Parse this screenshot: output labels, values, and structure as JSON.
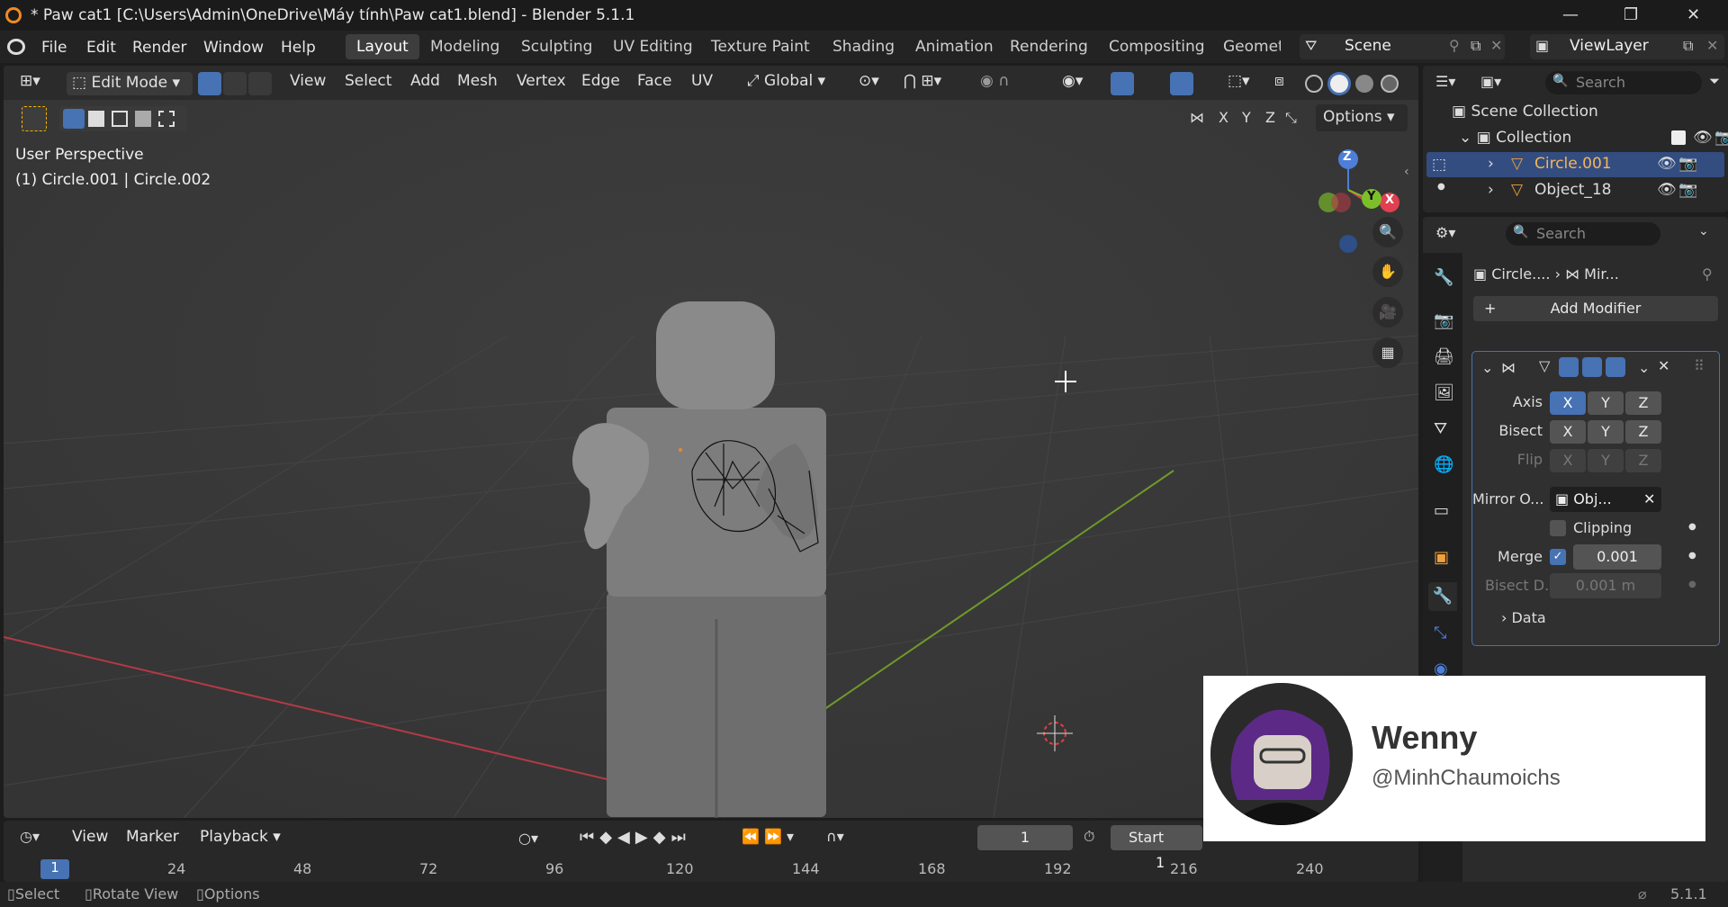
{
  "window": {
    "title": "* Paw cat1 [C:\\Users\\Admin\\OneDrive\\Máy tính\\Paw cat1.blend] - Blender 5.1.1"
  },
  "menu": [
    "File",
    "Edit",
    "Render",
    "Window",
    "Help"
  ],
  "workspaces": [
    "Layout",
    "Modeling",
    "Sculpting",
    "UV Editing",
    "Texture Paint",
    "Shading",
    "Animation",
    "Rendering",
    "Compositing",
    "Geometr"
  ],
  "scene": {
    "label": "Scene",
    "view_layer": "ViewLayer"
  },
  "viewport_header": {
    "mode": "Edit Mode",
    "menus": [
      "View",
      "Select",
      "Add",
      "Mesh",
      "Vertex",
      "Edge",
      "Face",
      "UV"
    ],
    "transform_orientation": "Global",
    "options": "Options",
    "axes": [
      "X",
      "Y",
      "Z"
    ]
  },
  "viewport": {
    "perspective": "User Perspective",
    "object_info": "(1) Circle.001 | Circle.002",
    "gizmo_axes": [
      "Z",
      "Y",
      "X"
    ]
  },
  "outliner": {
    "search_placeholder": "Search",
    "scene_collection": "Scene Collection",
    "collection": "Collection",
    "items": [
      "Circle.001",
      "Object_18"
    ]
  },
  "properties": {
    "search_placeholder": "Search",
    "breadcrumb_object": "Circle....",
    "breadcrumb_modifier": "Mir...",
    "add_modifier": "Add Modifier",
    "axis_label": "Axis",
    "bisect_label": "Bisect",
    "flip_label": "Flip",
    "xyz": [
      "X",
      "Y",
      "Z"
    ],
    "mirror_object_label": "Mirror O...",
    "mirror_object_value": "Obj...",
    "clipping_label": "Clipping",
    "merge_label": "Merge",
    "merge_value": "0.001",
    "bisect_distance_label": "Bisect D...",
    "bisect_distance_value": "0.001 m",
    "data_label": "Data"
  },
  "timeline": {
    "menus": [
      "View",
      "Marker",
      "Playback"
    ],
    "current_frame": "1",
    "start_label": "Start",
    "start_value": "1",
    "ticks": [
      "1",
      "24",
      "48",
      "72",
      "96",
      "120",
      "144",
      "168",
      "192",
      "216",
      "240"
    ]
  },
  "status": {
    "items": [
      "Select",
      "Rotate View",
      "Options"
    ],
    "version": "5.1.1"
  },
  "overlay_card": {
    "name": "Wenny",
    "handle": "@MinhChaumoichs"
  },
  "colors": {
    "accent": "#4772b3",
    "x_axis": "#e0404f",
    "y_axis": "#7cbf2a",
    "z_axis": "#4d7fd8"
  }
}
